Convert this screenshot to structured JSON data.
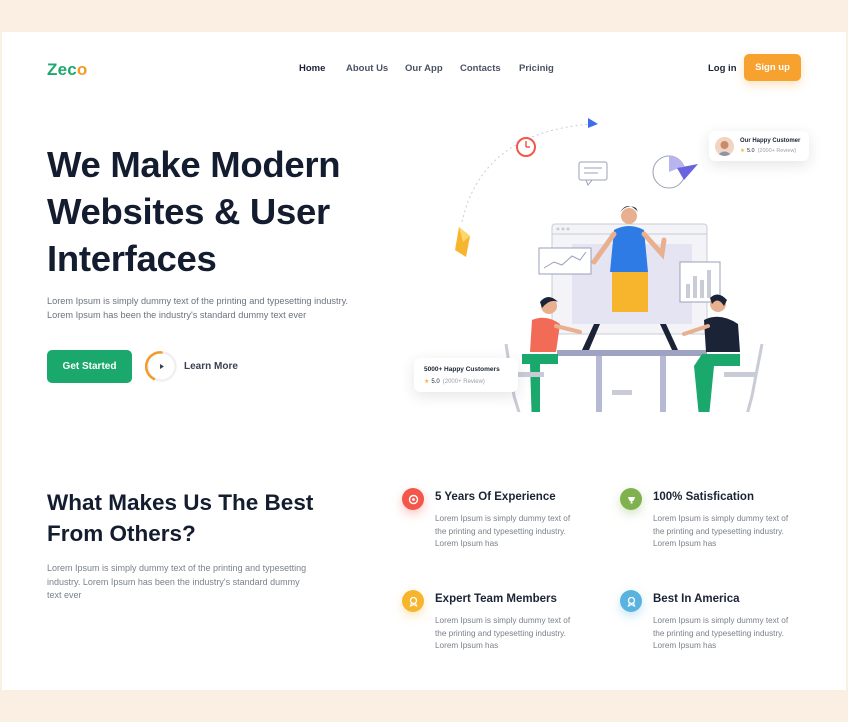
{
  "brand": {
    "logo_main": "Zec",
    "logo_accent": "o"
  },
  "nav": {
    "items": [
      {
        "label": "Home",
        "active": true
      },
      {
        "label": "About Us",
        "active": false
      },
      {
        "label": "Our App",
        "active": false
      },
      {
        "label": "Contacts",
        "active": false
      },
      {
        "label": "Pricinig",
        "active": false
      }
    ],
    "login_label": "Log in",
    "signup_label": "Sign up"
  },
  "hero": {
    "title_lines": [
      "We Make Modern",
      "Websites & User",
      "Interfaces"
    ],
    "desc_lines": [
      "Lorem Ipsum is simply dummy text of the printing and typesetting industry.",
      "Lorem Ipsum has been the industry's standard dummy text ever"
    ],
    "primary_button": "Get Started",
    "secondary_button": "Learn More"
  },
  "illustration": {
    "customer_card": {
      "title": "Our Happy Customer",
      "rating": "5.0",
      "reviews": "(2000+ Review)"
    },
    "happy_card": {
      "title": "5000+ Happy Customers",
      "rating": "5.0",
      "reviews": "(2000+ Review)"
    }
  },
  "section2": {
    "title_lines": [
      "What Makes Us The Best",
      "From Others?"
    ],
    "desc_lines": [
      "Lorem Ipsum is simply dummy text of the printing and typesetting",
      "industry. Lorem Ipsum has been the industry's standard dummy",
      "text ever"
    ],
    "features": [
      {
        "title": "5 Years Of Experience",
        "icon": "experience-icon",
        "color": "#f2574a",
        "desc_lines": [
          "Lorem Ipsum is simply dummy text of",
          "the printing and typesetting industry.",
          "Lorem Ipsum has"
        ]
      },
      {
        "title": "100% Satisfication",
        "icon": "satisfaction-icon",
        "color": "#7fb24e",
        "desc_lines": [
          "Lorem Ipsum is simply dummy text of",
          "the printing and typesetting industry.",
          "Lorem Ipsum has"
        ]
      },
      {
        "title": "Expert Team Members",
        "icon": "team-icon",
        "color": "#f6b52c",
        "desc_lines": [
          "Lorem Ipsum is simply dummy text of",
          "the printing and typesetting industry.",
          "Lorem Ipsum has"
        ]
      },
      {
        "title": "Best In America",
        "icon": "award-icon",
        "color": "#5ab3de",
        "desc_lines": [
          "Lorem Ipsum is simply dummy text of",
          "the printing and typesetting industry.",
          "Lorem Ipsum has"
        ]
      }
    ]
  },
  "colors": {
    "brand_green": "#1ea870",
    "accent_orange": "#f7a12f",
    "page_background": "#fbeee2",
    "heading": "#141c2f"
  }
}
